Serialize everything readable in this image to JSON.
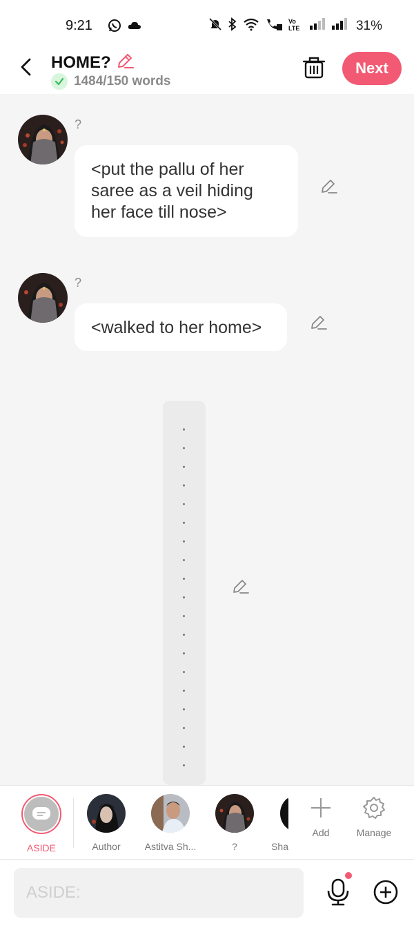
{
  "status_bar": {
    "time": "9:21",
    "battery": "31%",
    "icons": [
      "whatsapp-icon",
      "cloud-icon",
      "mute-icon",
      "bluetooth-icon",
      "wifi-icon",
      "wifi-calling-icon",
      "volte-icon",
      "signal-icon",
      "signal-icon"
    ]
  },
  "header": {
    "title": "HOME?",
    "word_count": "1484/150 words",
    "next_label": "Next"
  },
  "messages": [
    {
      "sender": "?",
      "text": "<put the pallu of her saree as a veil hiding her face till nose>"
    },
    {
      "sender": "?",
      "text": "<walked to her home>"
    }
  ],
  "characters": [
    {
      "label": "ASIDE",
      "active": true
    },
    {
      "label": "Author"
    },
    {
      "label": "Astitva Sh..."
    },
    {
      "label": "?"
    },
    {
      "label": "Sha"
    }
  ],
  "actions": {
    "add_label": "Add",
    "manage_label": "Manage"
  },
  "input": {
    "placeholder": "ASIDE:"
  },
  "colors": {
    "accent": "#f25a73",
    "background": "#f5f5f5"
  }
}
